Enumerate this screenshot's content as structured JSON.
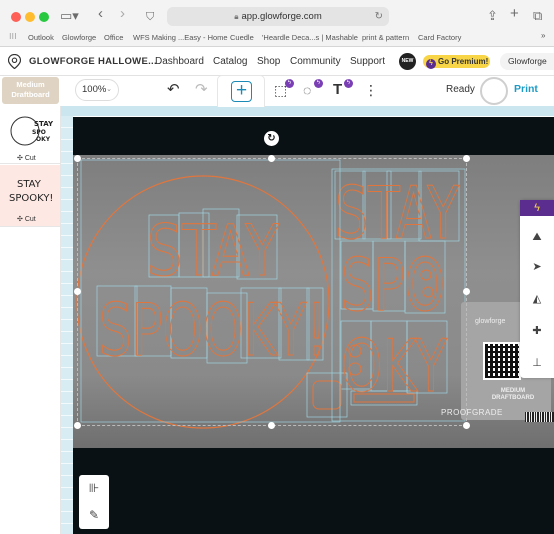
{
  "browser": {
    "url": "app.glowforge.com",
    "bookmarks": [
      "Outlook",
      "Glowforge",
      "Office",
      "WFS Making ...Easy - Home",
      "Cuedle",
      "'Heardle Deca...s | Mashable",
      "print & pattern",
      "Card Factory"
    ]
  },
  "app": {
    "title": "GLOWFORGE HALLOWE...",
    "nav": [
      "Dashboard",
      "Catalog",
      "Shop",
      "Community",
      "Support"
    ],
    "new_badge": "NEW",
    "premium_label": "Go Premium!",
    "machine_name": "Glowforge"
  },
  "toolbar": {
    "material_label": "Medium Draftboard",
    "zoom": "100%",
    "status": "Ready",
    "print_label": "Print"
  },
  "left_panel": {
    "items": [
      {
        "name": "circle-stay-spooky-design",
        "step": "Cut"
      },
      {
        "name": "stay-spooky-text-design",
        "thumb_text": "STAY SPOOKY!",
        "step": "Cut"
      }
    ]
  },
  "canvas": {
    "artwork_text_left": [
      "STAY",
      "SPOOKY!"
    ],
    "artwork_text_right": [
      "STAY",
      "SPOOKY"
    ],
    "sticker": {
      "brand": "glowforge",
      "material": "MEDIUM DRAFTBOARD",
      "grade": "PROOFGRADE"
    }
  },
  "colors": {
    "accent": "#1b9bc6",
    "premium_yellow": "#f7d547",
    "premium_purple": "#5b2d8e",
    "cut_line": "#e0763e",
    "bed": "#0a1114"
  },
  "icons": {
    "sidebar_toggle": "sidebar-icon",
    "back": "chevron-left-icon",
    "forward": "chevron-right-icon",
    "shield": "shield-icon",
    "share": "share-icon",
    "new_tab": "plus-icon",
    "tabs": "tabs-icon",
    "undo": "undo-icon",
    "redo": "redo-icon",
    "add_artwork": "add-artwork-icon",
    "trace": "trace-icon",
    "shapes": "shapes-icon",
    "text": "text-icon",
    "more": "more-icon"
  }
}
